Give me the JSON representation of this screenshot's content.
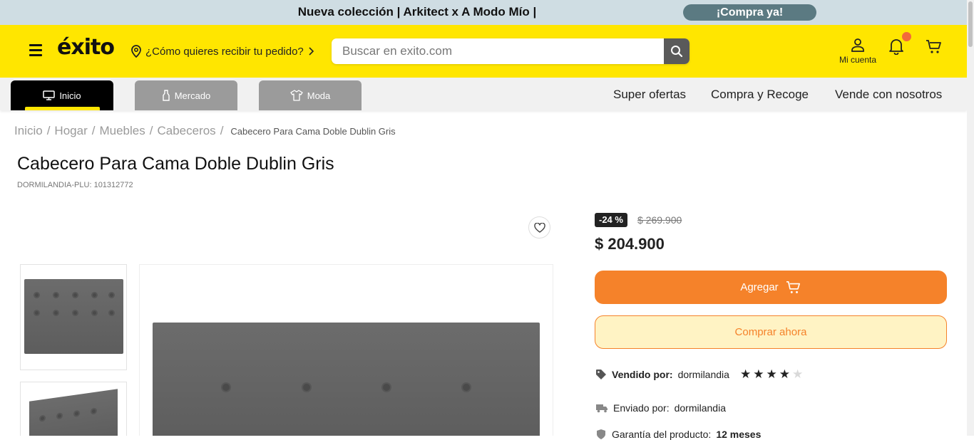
{
  "promo": {
    "text": "Nueva colección | Arkitect x A Modo Mío |",
    "cta": "¡Compra ya!"
  },
  "header": {
    "logo": "éxito",
    "delivery_prompt": "¿Cómo quieres recibir tu pedido?",
    "search_placeholder": "Buscar en exito.com",
    "account_label": "Mi cuenta"
  },
  "categories": [
    {
      "label": "Inicio",
      "icon": "monitor-icon",
      "active": true
    },
    {
      "label": "Mercado",
      "icon": "bottle-icon",
      "active": false
    },
    {
      "label": "Moda",
      "icon": "shirt-icon",
      "active": false
    }
  ],
  "top_links": [
    "Super ofertas",
    "Compra y Recoge",
    "Vende con nosotros"
  ],
  "breadcrumb": {
    "items": [
      "Inicio",
      "Hogar",
      "Muebles",
      "Cabeceros"
    ],
    "current": "Cabecero Para Cama Doble Dublin Gris"
  },
  "product": {
    "title": "Cabecero Para Cama Doble Dublin Gris",
    "plu": "DORMILANDIA-PLU: 101312772",
    "discount": "-24 %",
    "old_price": "$ 269.900",
    "price": "$ 204.900",
    "add_label": "Agregar",
    "buy_now_label": "Comprar ahora",
    "sold_by_label": "Vendido por:",
    "sold_by": "dormilandia",
    "rating": 4,
    "rating_max": 5,
    "shipped_by_label": "Enviado por:",
    "shipped_by": "dormilandia",
    "warranty_label": "Garantía del producto:",
    "warranty": "12 meses"
  },
  "colors": {
    "brand_yellow": "#ffe600",
    "accent_orange": "#f5822a",
    "promo_bg": "#cfdde3",
    "promo_button": "#5b7a82",
    "notification_dot": "#f26a3b"
  }
}
